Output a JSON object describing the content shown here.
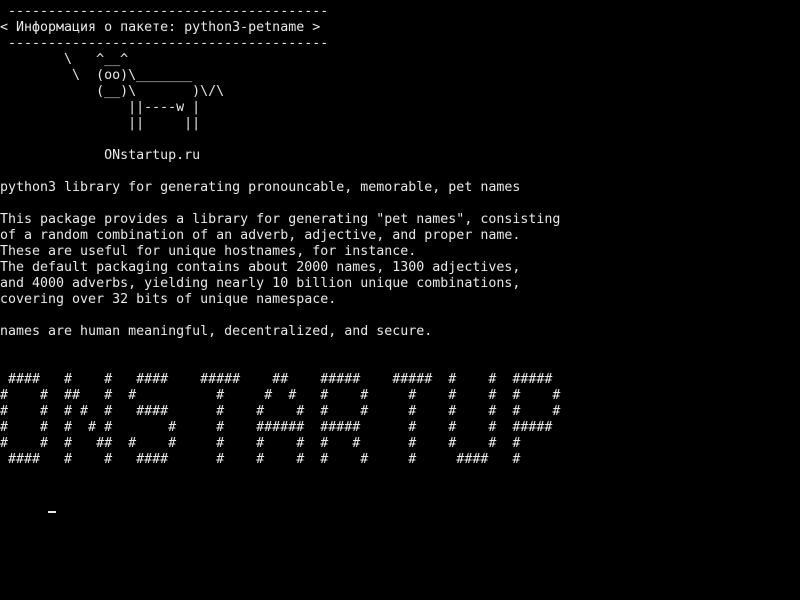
{
  "terminal": {
    "colors": {
      "background": "#000000",
      "foreground": "#e8e8e8"
    },
    "lines": [
      " ----------------------------------------",
      "< Информация о пакете: python3-petname >",
      " ----------------------------------------",
      "        \\   ^__^",
      "         \\  (oo)\\_______",
      "            (__)\\       )\\/\\",
      "                ||----w |",
      "                ||     ||",
      "",
      "             ONstartup.ru",
      "",
      "python3 library for generating pronouncable, memorable, pet names",
      "",
      "This package provides a library for generating \"pet names\", consisting",
      "of a random combination of an adverb, adjective, and proper name.",
      "These are useful for unique hostnames, for instance.",
      "The default packaging contains about 2000 names, 1300 adjectives,",
      "and 4000 adverbs, yielding nearly 10 billion unique combinations,",
      "covering over 32 bits of unique namespace.",
      "",
      "names are human meaningful, decentralized, and secure.",
      "",
      "",
      " ####   #    #   ####    #####    ##    #####    #####  #    #  #####",
      "#    #  ##   #  #          #     #  #   #    #     #    #    #  #    #",
      "#    #  # #  #   ####      #    #    #  #    #     #    #    #  #    #",
      "#    #  #  # #       #     #    ######  #####      #    #    #  #####",
      "#    #  #   ##  #    #     #    #    #  #   #      #    #    #  #",
      " ####   #    #   ####      #    #    #  #    #     #     ####   #",
      ""
    ],
    "prompt": ""
  }
}
